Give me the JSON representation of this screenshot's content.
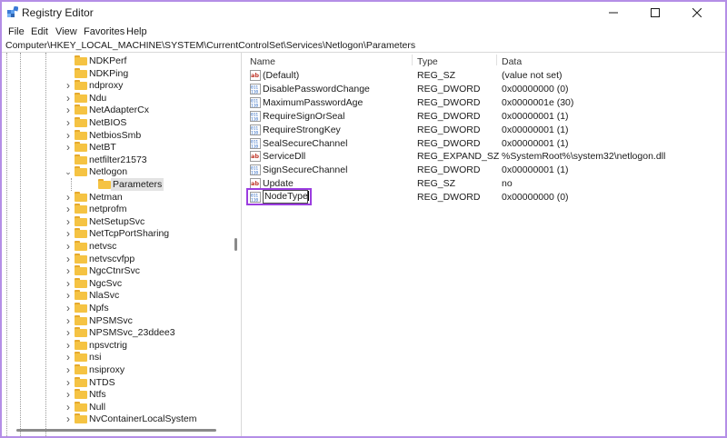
{
  "window": {
    "title": "Registry Editor",
    "controls": {
      "minimize": "minimize-icon",
      "maximize": "maximize-icon",
      "close": "close-icon"
    }
  },
  "menu": [
    "File",
    "Edit",
    "View",
    "Favorites",
    "Help"
  ],
  "address": "Computer\\HKEY_LOCAL_MACHINE\\SYSTEM\\CurrentControlSet\\Services\\Netlogon\\Parameters",
  "tree": {
    "items": [
      {
        "label": "NDKPerf",
        "expandable": false
      },
      {
        "label": "NDKPing",
        "expandable": false
      },
      {
        "label": "ndproxy",
        "expandable": true
      },
      {
        "label": "Ndu",
        "expandable": true
      },
      {
        "label": "NetAdapterCx",
        "expandable": true
      },
      {
        "label": "NetBIOS",
        "expandable": true
      },
      {
        "label": "NetbiosSmb",
        "expandable": true
      },
      {
        "label": "NetBT",
        "expandable": true
      },
      {
        "label": "netfilter21573",
        "expandable": false
      },
      {
        "label": "Netlogon",
        "expandable": true,
        "expanded": true
      },
      {
        "label": "Parameters",
        "child": true,
        "selected": true
      },
      {
        "label": "Netman",
        "expandable": true
      },
      {
        "label": "netprofm",
        "expandable": true
      },
      {
        "label": "NetSetupSvc",
        "expandable": true
      },
      {
        "label": "NetTcpPortSharing",
        "expandable": true
      },
      {
        "label": "netvsc",
        "expandable": true
      },
      {
        "label": "netvscvfpp",
        "expandable": true
      },
      {
        "label": "NgcCtnrSvc",
        "expandable": true
      },
      {
        "label": "NgcSvc",
        "expandable": true
      },
      {
        "label": "NlaSvc",
        "expandable": true
      },
      {
        "label": "Npfs",
        "expandable": true
      },
      {
        "label": "NPSMSvc",
        "expandable": true
      },
      {
        "label": "NPSMSvc_23ddee3",
        "expandable": true
      },
      {
        "label": "npsvctrig",
        "expandable": true
      },
      {
        "label": "nsi",
        "expandable": true
      },
      {
        "label": "nsiproxy",
        "expandable": true
      },
      {
        "label": "NTDS",
        "expandable": true
      },
      {
        "label": "Ntfs",
        "expandable": true
      },
      {
        "label": "Null",
        "expandable": true
      },
      {
        "label": "NvContainerLocalSystem",
        "expandable": true
      }
    ]
  },
  "list": {
    "columns": [
      "Name",
      "Type",
      "Data"
    ],
    "rows": [
      {
        "name": "(Default)",
        "type": "REG_SZ",
        "data": "(value not set)",
        "icon": "string-value-icon"
      },
      {
        "name": "DisablePasswordChange",
        "type": "REG_DWORD",
        "data": "0x00000000 (0)",
        "icon": "binary-value-icon"
      },
      {
        "name": "MaximumPasswordAge",
        "type": "REG_DWORD",
        "data": "0x0000001e (30)",
        "icon": "binary-value-icon"
      },
      {
        "name": "RequireSignOrSeal",
        "type": "REG_DWORD",
        "data": "0x00000001 (1)",
        "icon": "binary-value-icon"
      },
      {
        "name": "RequireStrongKey",
        "type": "REG_DWORD",
        "data": "0x00000001 (1)",
        "icon": "binary-value-icon"
      },
      {
        "name": "SealSecureChannel",
        "type": "REG_DWORD",
        "data": "0x00000001 (1)",
        "icon": "binary-value-icon"
      },
      {
        "name": "ServiceDll",
        "type": "REG_EXPAND_SZ",
        "data": "%SystemRoot%\\system32\\netlogon.dll",
        "icon": "string-value-icon"
      },
      {
        "name": "SignSecureChannel",
        "type": "REG_DWORD",
        "data": "0x00000001 (1)",
        "icon": "binary-value-icon"
      },
      {
        "name": "Update",
        "type": "REG_SZ",
        "data": "no",
        "icon": "string-value-icon"
      },
      {
        "name": "",
        "type": "REG_DWORD",
        "data": "0x00000000 (0)",
        "icon": "binary-value-icon"
      }
    ],
    "rename_value": "NodeType"
  },
  "colors": {
    "highlight": "#9b3de0",
    "folder": "#f5c343",
    "background": "#b48ee6"
  }
}
